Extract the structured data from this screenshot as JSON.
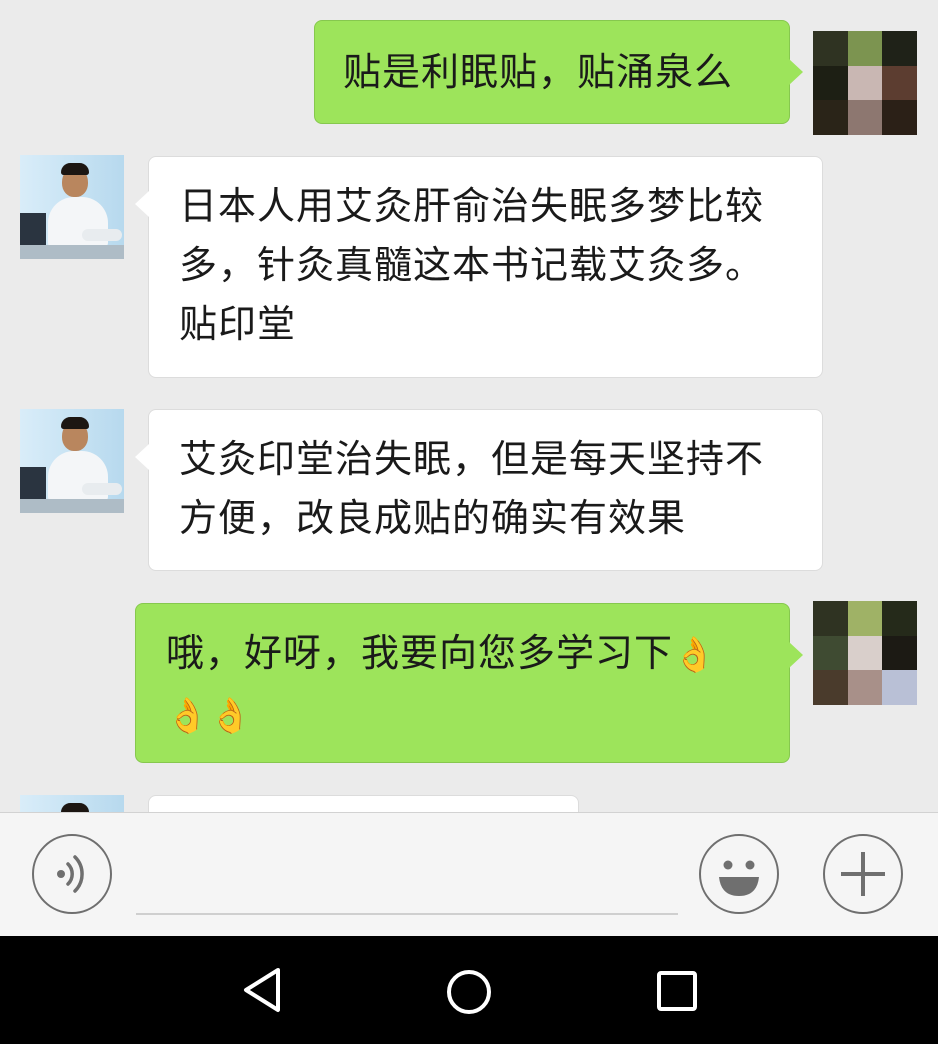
{
  "messages": [
    {
      "sender": "me",
      "text": "贴是利眠贴，贴涌泉么"
    },
    {
      "sender": "contact",
      "text": "日本人用艾灸肝俞治失眠多梦比较多，针灸真髓这本书记载艾灸多。贴印堂"
    },
    {
      "sender": "contact",
      "text": "艾灸印堂治失眠，但是每天坚持不方便，改良成贴的确实有效果"
    },
    {
      "sender": "me",
      "text": "哦，好呀，我要向您多学习下",
      "emoji": [
        "👌",
        "👌",
        "👌"
      ]
    },
    {
      "sender": "contact",
      "text": ""
    }
  ],
  "my_avatar_colors": [
    "#2f3322",
    "#7c9450",
    "#1f2218",
    "#1d1f14",
    "#c9b7b3",
    "#5c3d30",
    "#2a2418",
    "#8d7770",
    "#2b2017"
  ],
  "my_avatar_colors_2": [
    "#2f3322",
    "#9fb266",
    "#252a1a",
    "#3f4b32",
    "#d9cfcb",
    "#1c1a14",
    "#4a3b2c",
    "#a89089",
    "#b9c0d6"
  ],
  "input_bar": {
    "voice_icon": "voice-icon",
    "emoji_icon": "emoji-icon",
    "add_icon": "plus-icon",
    "input_value": ""
  },
  "nav_bar": {
    "back_icon": "back-triangle-icon",
    "home_icon": "home-circle-icon",
    "recent_icon": "recent-square-icon"
  },
  "colors": {
    "chat_background": "#ebebeb",
    "outgoing_bubble": "#9de45b",
    "incoming_bubble": "#ffffff"
  }
}
